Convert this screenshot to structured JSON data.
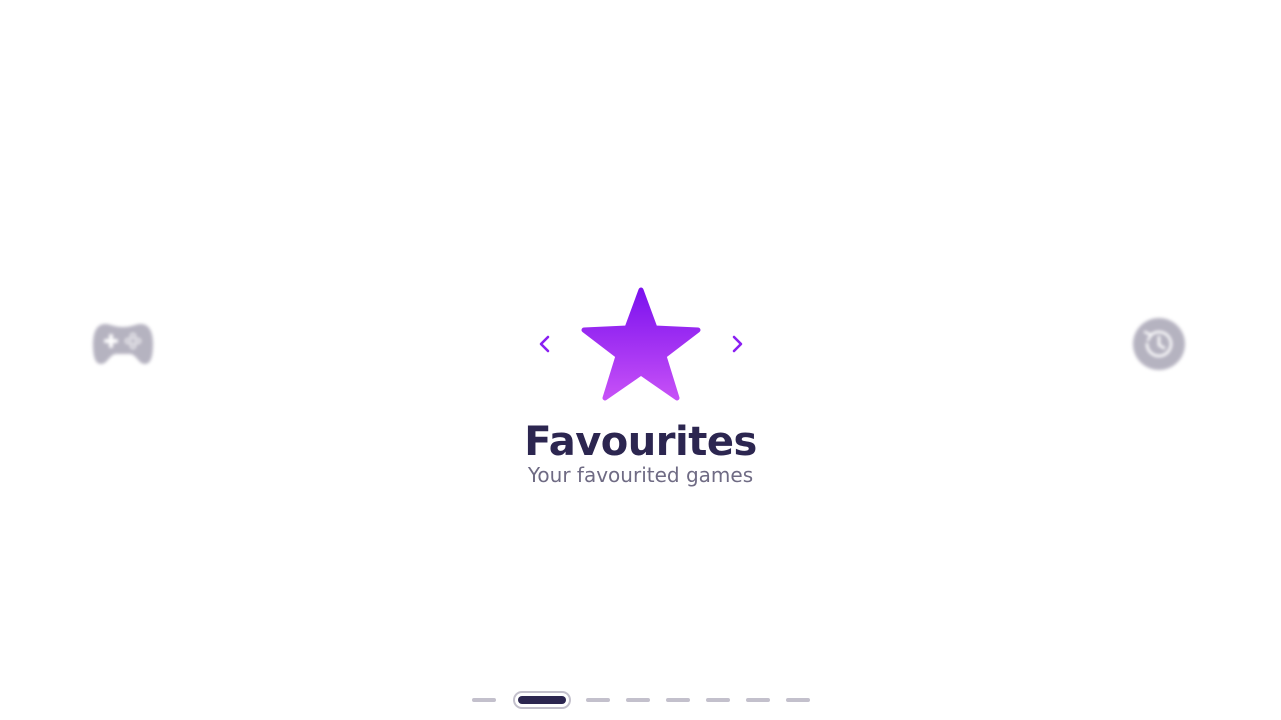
{
  "carousel": {
    "current": {
      "title": "Favourites",
      "subtitle": "Your favourited games",
      "icon": "star-icon"
    },
    "previous_icon": "gamepad-icon",
    "next_icon": "history-icon",
    "prev_arrow_icon": "chevron-left-icon",
    "next_arrow_icon": "chevron-right-icon"
  },
  "pager": {
    "count": 8,
    "active_index": 1
  },
  "colors": {
    "accent": "#8a1ff2",
    "accent_gradient_end": "#c04cf7",
    "title": "#2c2650",
    "subtitle": "#6f6b84",
    "inactive": "#a9a6b6"
  }
}
